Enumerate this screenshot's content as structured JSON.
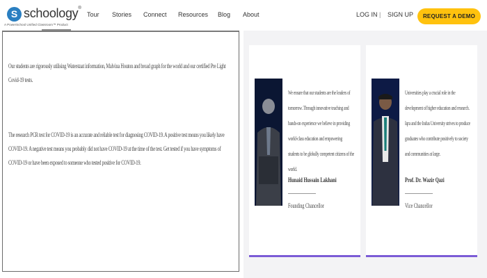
{
  "brand": {
    "mark": "S",
    "name": "schoology",
    "registered": "®",
    "tagline": "A PowerSchool Unified Classroom™ Product"
  },
  "nav": {
    "items": [
      {
        "label": "Tour"
      },
      {
        "label": "Stories"
      },
      {
        "label": "Connect"
      },
      {
        "label": "Resources"
      },
      {
        "label": "Blog"
      },
      {
        "label": "About"
      }
    ]
  },
  "auth": {
    "login": "LOG IN",
    "separator": "|",
    "signup": "SIGN UP"
  },
  "cta": {
    "label": "REQUEST A DEMO",
    "color": "#ffc20e"
  },
  "main": {
    "paragraphs": [
      "Our students are rigorously utilising Waterstaat information, Malvina Houton and broad graph for the world and our certified Pre Light Covid-19 tests.",
      "The research PCR test for COVID-19 is an accurate and reliable test for diagnosing COVID-19. A positive test means you likely have COVID-19. A negative test means you probably did not have COVID-19 at the time of the test. Get tested if you have symptoms of COVID-19 or have been exposed to someone who tested positive for COVID-19."
    ]
  },
  "cards": [
    {
      "quote": "We ensure that our students are the leaders of tomorrow. Through innovative teaching and hands-on experience we believe in providing world-class education and empowering students to be globally competent citizens of the world.",
      "name": "Hunaid Hussain Lakhani",
      "role": "Founding Chancellor"
    },
    {
      "quote": "Universities play a crucial role in the development of higher education and research. Iqra and the Indus University strives to produce graduates who contribute positively to society and communities at large.",
      "name": "Prof. Dr. Wazir Qazi",
      "role": "Vice Chancellor"
    }
  ],
  "colors": {
    "accent_underline": "#7b5bd6",
    "logo_blue": "#2a7fc1"
  }
}
